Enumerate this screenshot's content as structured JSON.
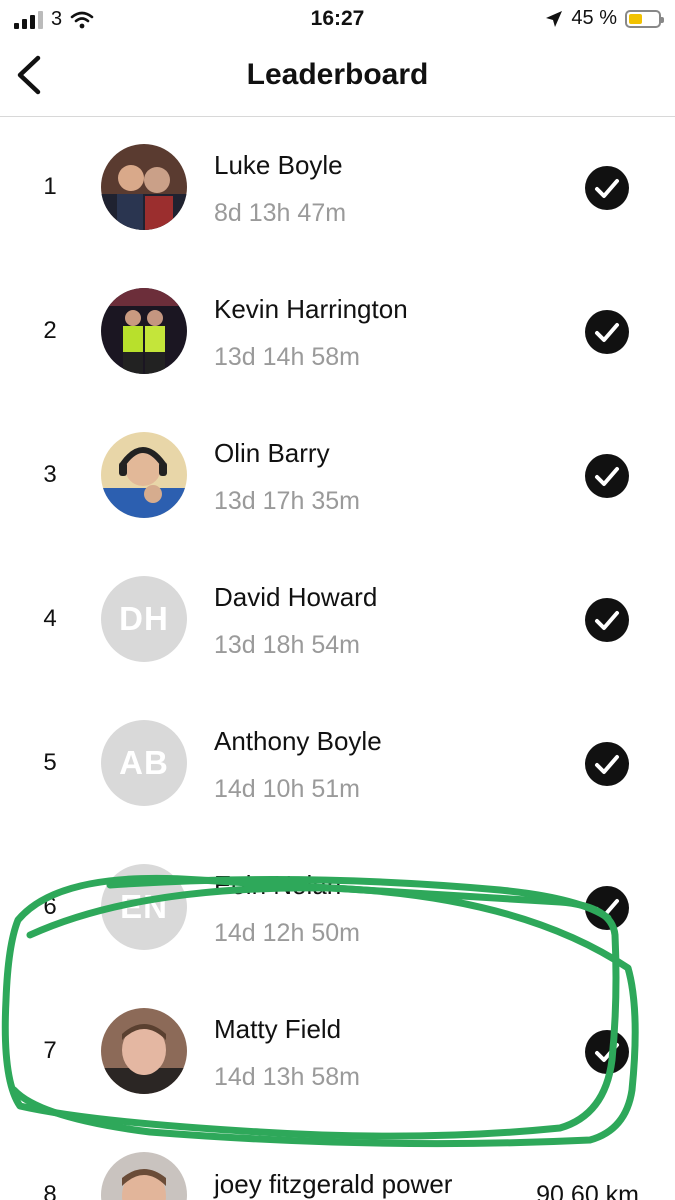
{
  "status_bar": {
    "carrier": "3",
    "time": "16:27",
    "battery_percent": "45 %",
    "battery_level": 0.45
  },
  "nav": {
    "title": "Leaderboard"
  },
  "colors": {
    "highlight": "#2ea85a",
    "initials_bg": "#d9d9d9"
  },
  "rows": [
    {
      "rank": "1",
      "name": "Luke Boyle",
      "time": "8d 13h 47m",
      "avatar": "photo"
    },
    {
      "rank": "2",
      "name": "Kevin Harrington",
      "time": "13d 14h 58m",
      "avatar": "photo"
    },
    {
      "rank": "3",
      "name": "Olin Barry",
      "time": "13d 17h 35m",
      "avatar": "photo"
    },
    {
      "rank": "4",
      "name": "David Howard",
      "time": "13d 18h 54m",
      "avatar": "DH"
    },
    {
      "rank": "5",
      "name": "Anthony Boyle",
      "time": "14d 10h 51m",
      "avatar": "AB"
    },
    {
      "rank": "6",
      "name": "Eoin Nolan",
      "time": "14d 12h 50m",
      "avatar": "EN"
    },
    {
      "rank": "7",
      "name": "Matty Field",
      "time": "14d 13h 58m",
      "avatar": "photo"
    },
    {
      "rank": "8",
      "name": "joey fitzgerald power",
      "distance": "90.60 km",
      "avatar": "photo"
    }
  ]
}
